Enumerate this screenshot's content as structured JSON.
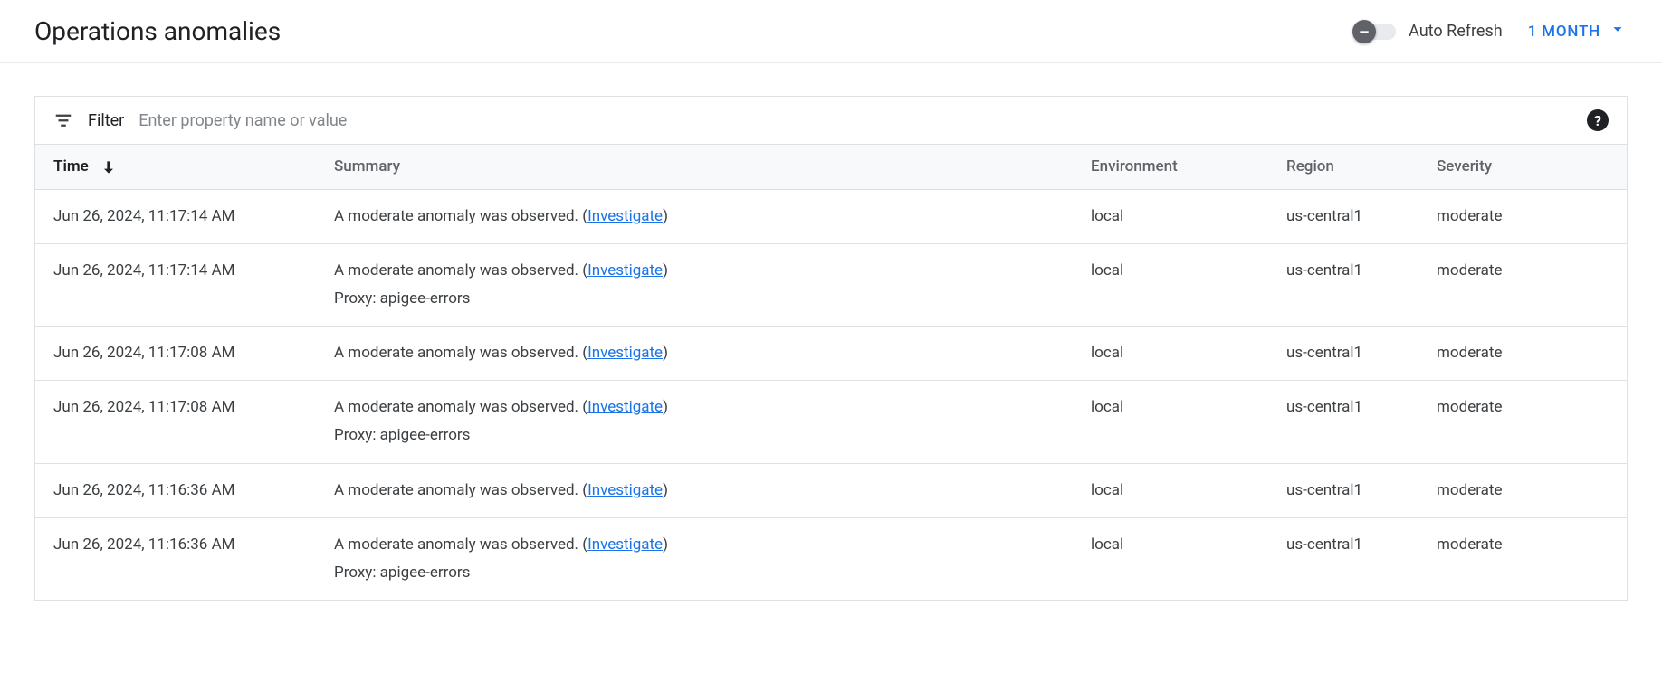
{
  "header": {
    "title": "Operations anomalies",
    "auto_refresh_label": "Auto Refresh",
    "time_range_label": "1 MONTH"
  },
  "filter": {
    "label": "Filter",
    "placeholder": "Enter property name or value"
  },
  "table": {
    "columns": {
      "time": "Time",
      "summary": "Summary",
      "environment": "Environment",
      "region": "Region",
      "severity": "Severity"
    },
    "rows": [
      {
        "time": "Jun 26, 2024, 11:17:14 AM",
        "summary_text": "A moderate anomaly was observed.",
        "investigate": "Investigate",
        "proxy": "",
        "environment": "local",
        "region": "us-central1",
        "severity": "moderate"
      },
      {
        "time": "Jun 26, 2024, 11:17:14 AM",
        "summary_text": "A moderate anomaly was observed.",
        "investigate": "Investigate",
        "proxy": "Proxy: apigee-errors",
        "environment": "local",
        "region": "us-central1",
        "severity": "moderate"
      },
      {
        "time": "Jun 26, 2024, 11:17:08 AM",
        "summary_text": "A moderate anomaly was observed.",
        "investigate": "Investigate",
        "proxy": "",
        "environment": "local",
        "region": "us-central1",
        "severity": "moderate"
      },
      {
        "time": "Jun 26, 2024, 11:17:08 AM",
        "summary_text": "A moderate anomaly was observed.",
        "investigate": "Investigate",
        "proxy": "Proxy: apigee-errors",
        "environment": "local",
        "region": "us-central1",
        "severity": "moderate"
      },
      {
        "time": "Jun 26, 2024, 11:16:36 AM",
        "summary_text": "A moderate anomaly was observed.",
        "investigate": "Investigate",
        "proxy": "",
        "environment": "local",
        "region": "us-central1",
        "severity": "moderate"
      },
      {
        "time": "Jun 26, 2024, 11:16:36 AM",
        "summary_text": "A moderate anomaly was observed.",
        "investigate": "Investigate",
        "proxy": "Proxy: apigee-errors",
        "environment": "local",
        "region": "us-central1",
        "severity": "moderate"
      }
    ]
  }
}
